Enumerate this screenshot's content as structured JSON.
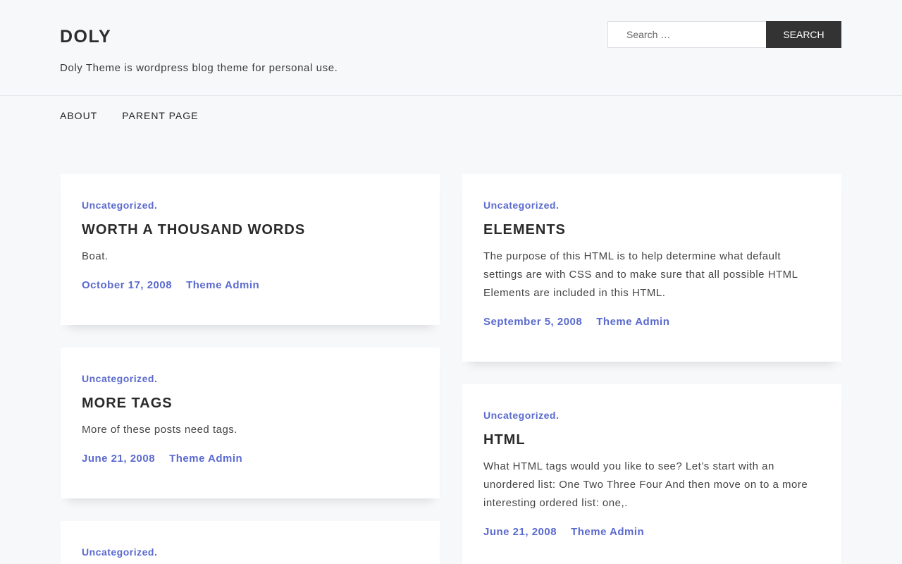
{
  "site": {
    "title": "DOLY",
    "tagline": "Doly Theme is wordpress blog theme for personal use."
  },
  "search": {
    "placeholder": "Search …",
    "button_label": "SEARCH"
  },
  "nav": {
    "items": [
      {
        "label": "ABOUT"
      },
      {
        "label": "PARENT PAGE"
      }
    ]
  },
  "colors": {
    "accent": "#5a6acf",
    "background": "#f7f8fa",
    "button": "#333333"
  },
  "posts": [
    {
      "category": "Uncategorized",
      "sep": ".",
      "title": "WORTH A THOUSAND WORDS",
      "excerpt": "Boat.",
      "date": "October 17, 2008",
      "author": "Theme Admin"
    },
    {
      "category": "Uncategorized",
      "sep": ".",
      "title": "ELEMENTS",
      "excerpt": "The purpose of this HTML is to help determine what default settings are with CSS and to make sure that all possible HTML Elements are included in this HTML.",
      "date": "September 5, 2008",
      "author": "Theme Admin"
    },
    {
      "category": "Uncategorized",
      "sep": ".",
      "title": "MORE TAGS",
      "excerpt": "More of these posts need tags.",
      "date": "June 21, 2008",
      "author": "Theme Admin"
    },
    {
      "category": "Uncategorized",
      "sep": ".",
      "title": "HTML",
      "excerpt": "What HTML tags would you like to see? Let’s start with an unordered list: One Two Three Four And then move on to a more interesting ordered list: one,.",
      "date": "June 21, 2008",
      "author": "Theme Admin"
    },
    {
      "category": "Uncategorized",
      "sep": "."
    }
  ]
}
